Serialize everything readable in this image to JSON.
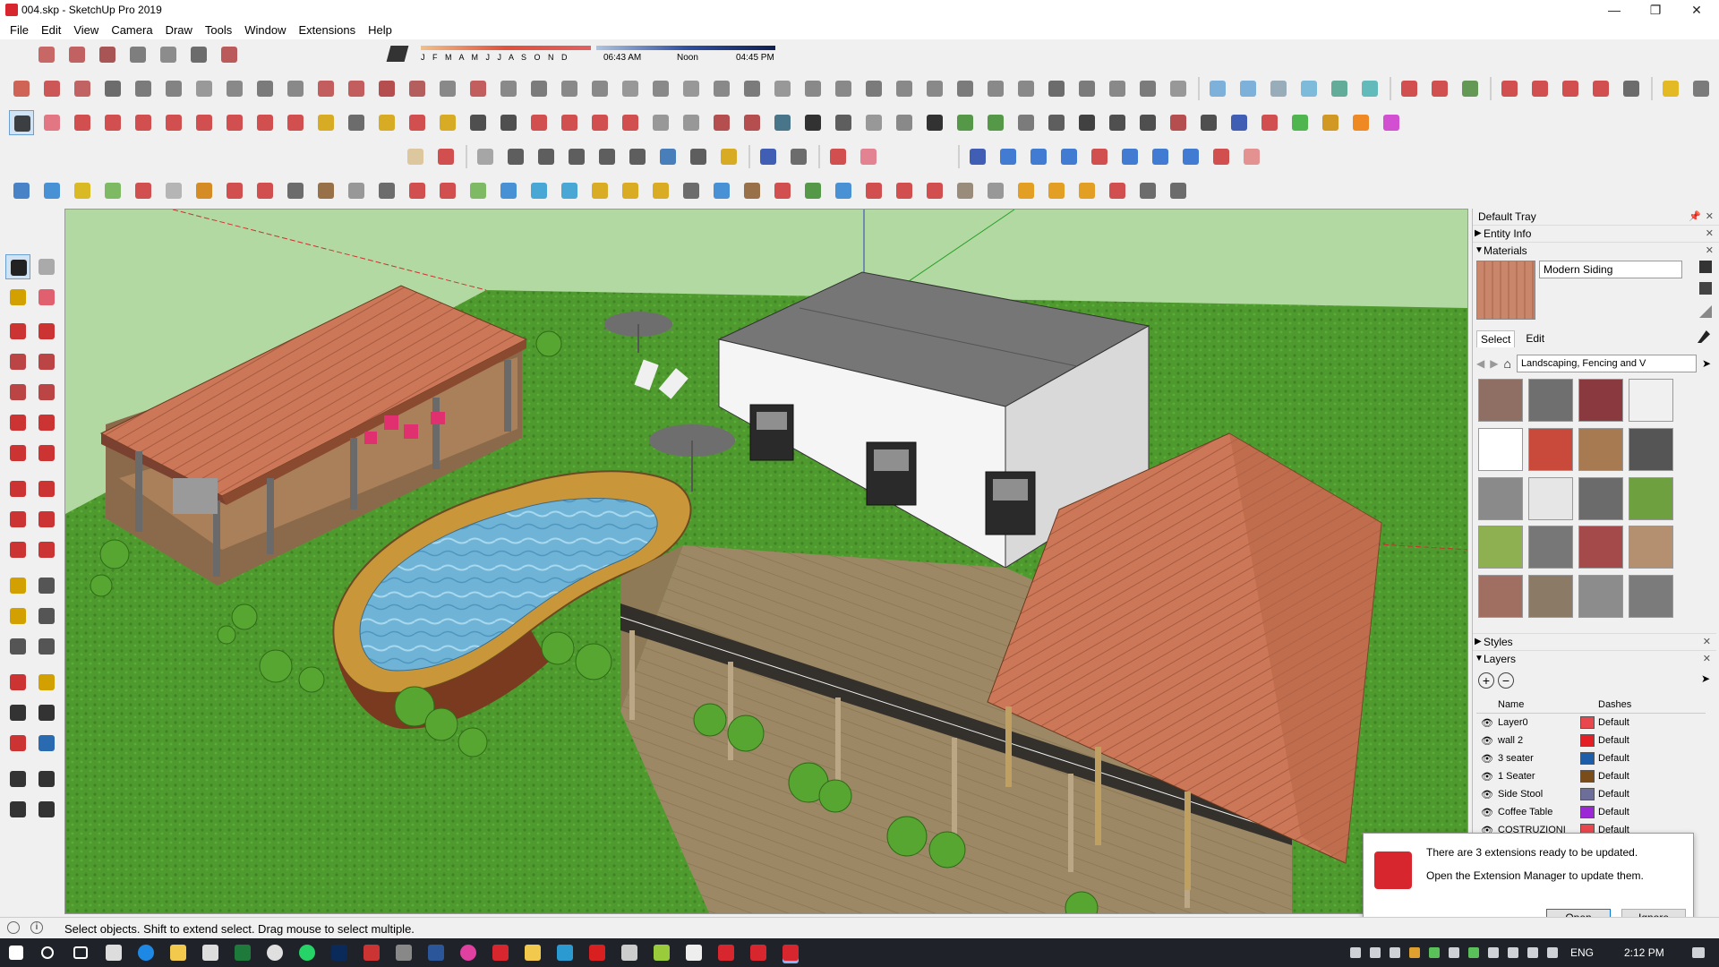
{
  "window": {
    "title": "004.skp - SketchUp Pro 2019",
    "controls": [
      "—",
      "❐",
      "✕"
    ]
  },
  "menu": [
    "File",
    "Edit",
    "View",
    "Camera",
    "Draw",
    "Tools",
    "Window",
    "Extensions",
    "Help"
  ],
  "shadows": {
    "months": "J F M A M J J A S O N D",
    "time_start": "06:43 AM",
    "time_mid": "Noon",
    "time_end": "04:45 PM"
  },
  "tray": {
    "title": "Default Tray",
    "entity_info": "Entity Info",
    "materials": {
      "header": "Materials",
      "current": "Modern Siding",
      "tabs": [
        "Select",
        "Edit"
      ],
      "library": "Landscaping, Fencing and V",
      "swatches": [
        "#8f6f63",
        "#6f6f6f",
        "#8a3a3f",
        "#f0f0f0",
        "#ffffff",
        "#c94a3a",
        "#a87a52",
        "#555555",
        "#8a8a8a",
        "#e6e6e6",
        "#6b6b6b",
        "#6fa040",
        "#8fb050",
        "#777777",
        "#a54a4a",
        "#b49070",
        "#a06f62",
        "#8a7a66",
        "#8c8c8c",
        "#7b7b7b"
      ]
    },
    "styles": "Styles",
    "layers": {
      "header": "Layers",
      "col_name": "Name",
      "col_dashes": "Dashes",
      "rows": [
        {
          "name": "Layer0",
          "color": "#e8474d",
          "dashes": "Default"
        },
        {
          "name": "wall 2",
          "color": "#e31e24",
          "dashes": "Default"
        },
        {
          "name": "3 seater",
          "color": "#1c5fa8",
          "dashes": "Default"
        },
        {
          "name": "1 Seater",
          "color": "#7a4c1a",
          "dashes": "Default"
        },
        {
          "name": "Side Stool",
          "color": "#6e6e9a",
          "dashes": "Default"
        },
        {
          "name": "Coffee Table",
          "color": "#9b27d6",
          "dashes": "Default"
        },
        {
          "name": "COSTRUZIONI",
          "color": "#e8474d",
          "dashes": "Default"
        }
      ]
    }
  },
  "notification": {
    "line1": "There are 3 extensions ready to be updated.",
    "line2": "Open the Extension Manager to update them.",
    "open": "Open",
    "ignore": "Ignore"
  },
  "status": {
    "message": "Select objects. Shift to extend select. Drag mouse to select multiple."
  },
  "taskbar": {
    "lang": "ENG",
    "time": "2:12 PM"
  }
}
